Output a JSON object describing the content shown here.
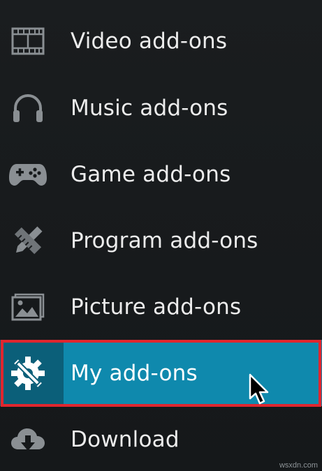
{
  "menu": {
    "items": [
      {
        "label": "Video add-ons",
        "icon": "film-icon"
      },
      {
        "label": "Music add-ons",
        "icon": "headphones-icon"
      },
      {
        "label": "Game add-ons",
        "icon": "gamepad-icon"
      },
      {
        "label": "Program add-ons",
        "icon": "pencil-ruler-icon"
      },
      {
        "label": "Picture add-ons",
        "icon": "picture-icon"
      },
      {
        "label": "My add-ons",
        "icon": "gear-wrench-icon",
        "selected": true
      },
      {
        "label": "Download",
        "icon": "cloud-download-icon"
      }
    ]
  },
  "colors": {
    "background": "#16191b",
    "selected_bg": "#0f89ad",
    "selected_icon_bg": "#0b5f79",
    "highlight_border": "#e0262e",
    "text": "#ececec",
    "icon": "#8a8f93"
  },
  "watermark": "wsxdn.com"
}
